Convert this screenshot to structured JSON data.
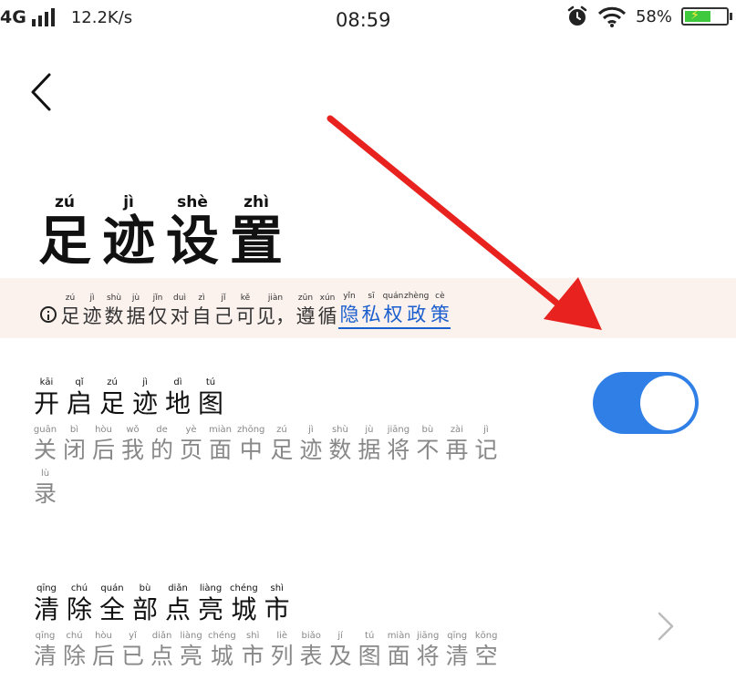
{
  "status_bar": {
    "network": "4G",
    "speed": "12.2K/s",
    "time": "08:59",
    "battery": "58%"
  },
  "page": {
    "title": [
      {
        "hz": "足",
        "py": "zú"
      },
      {
        "hz": "迹",
        "py": "jì"
      },
      {
        "hz": "设",
        "py": "shè"
      },
      {
        "hz": "置",
        "py": "zhì"
      }
    ]
  },
  "notice": {
    "text": [
      {
        "hz": "足",
        "py": "zú"
      },
      {
        "hz": "迹",
        "py": "jì"
      },
      {
        "hz": "数",
        "py": "shù"
      },
      {
        "hz": "据",
        "py": "jù"
      },
      {
        "hz": "仅",
        "py": "jǐn"
      },
      {
        "hz": "对",
        "py": "duì"
      },
      {
        "hz": "自",
        "py": "zì"
      },
      {
        "hz": "己",
        "py": "jǐ"
      },
      {
        "hz": "可",
        "py": "kě"
      },
      {
        "hz": "见，",
        "py": "jiàn"
      },
      {
        "hz": "遵",
        "py": "zūn"
      },
      {
        "hz": "循",
        "py": "xún"
      }
    ],
    "link": [
      {
        "hz": "隐",
        "py": "yǐn"
      },
      {
        "hz": "私",
        "py": "sī"
      },
      {
        "hz": "权",
        "py": "quán"
      },
      {
        "hz": "政",
        "py": "zhèng"
      },
      {
        "hz": "策",
        "py": "cè"
      }
    ]
  },
  "settings": {
    "footprint_map": {
      "title": [
        {
          "hz": "开",
          "py": "kāi"
        },
        {
          "hz": "启",
          "py": "qǐ"
        },
        {
          "hz": "足",
          "py": "zú"
        },
        {
          "hz": "迹",
          "py": "jì"
        },
        {
          "hz": "地",
          "py": "dì"
        },
        {
          "hz": "图",
          "py": "tú"
        }
      ],
      "desc_line1": [
        {
          "hz": "关",
          "py": "guān"
        },
        {
          "hz": "闭",
          "py": "bì"
        },
        {
          "hz": "后",
          "py": "hòu"
        },
        {
          "hz": "我",
          "py": "wǒ"
        },
        {
          "hz": "的",
          "py": "de"
        },
        {
          "hz": "页",
          "py": "yè"
        },
        {
          "hz": "面",
          "py": "miàn"
        },
        {
          "hz": "中",
          "py": "zhōng"
        },
        {
          "hz": "足",
          "py": "zú"
        },
        {
          "hz": "迹",
          "py": "jì"
        },
        {
          "hz": "数",
          "py": "shù"
        },
        {
          "hz": "据",
          "py": "jù"
        },
        {
          "hz": "将",
          "py": "jiāng"
        },
        {
          "hz": "不",
          "py": "bù"
        },
        {
          "hz": "再",
          "py": "zài"
        },
        {
          "hz": "记",
          "py": "jì"
        }
      ],
      "desc_line2": [
        {
          "hz": "录",
          "py": "lù"
        }
      ],
      "enabled": true
    },
    "clear_cities": {
      "title": [
        {
          "hz": "清",
          "py": "qīng"
        },
        {
          "hz": "除",
          "py": "chú"
        },
        {
          "hz": "全",
          "py": "quán"
        },
        {
          "hz": "部",
          "py": "bù"
        },
        {
          "hz": "点",
          "py": "diǎn"
        },
        {
          "hz": "亮",
          "py": "liàng"
        },
        {
          "hz": "城",
          "py": "chéng"
        },
        {
          "hz": "市",
          "py": "shì"
        }
      ],
      "desc_line1": [
        {
          "hz": "清",
          "py": "qīng"
        },
        {
          "hz": "除",
          "py": "chú"
        },
        {
          "hz": "后",
          "py": "hòu"
        },
        {
          "hz": "已",
          "py": "yǐ"
        },
        {
          "hz": "点",
          "py": "diǎn"
        },
        {
          "hz": "亮",
          "py": "liàng"
        },
        {
          "hz": "城",
          "py": "chéng"
        },
        {
          "hz": "市",
          "py": "shì"
        },
        {
          "hz": "列",
          "py": "liè"
        },
        {
          "hz": "表",
          "py": "biǎo"
        },
        {
          "hz": "及",
          "py": "jí"
        },
        {
          "hz": "图",
          "py": "tú"
        },
        {
          "hz": "面",
          "py": "miàn"
        },
        {
          "hz": "将",
          "py": "jiāng"
        },
        {
          "hz": "清",
          "py": "qīng"
        },
        {
          "hz": "空",
          "py": "kōng"
        }
      ]
    }
  },
  "icons": {
    "back": "chevron-left-icon",
    "info": "info-circle-icon",
    "arrow": "red-arrow-annotation",
    "row_chevron": "chevron-right-icon"
  },
  "colors": {
    "toggle_on": "#2f7fe6",
    "link": "#1b5fcf",
    "notice_bg": "#fbf1ed",
    "arrow": "#e8231f",
    "battery_fill": "#3fc93f"
  }
}
